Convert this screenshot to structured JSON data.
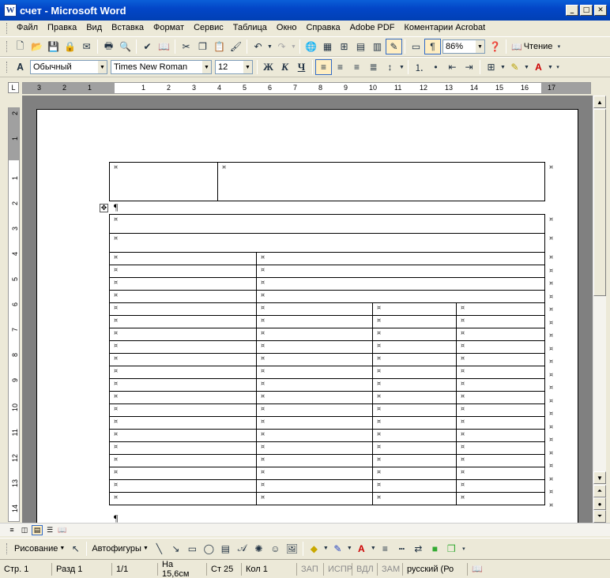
{
  "window": {
    "title": "счет - Microsoft Word",
    "app_icon": "W",
    "minimize": "_",
    "maximize": "□",
    "close": "✕"
  },
  "menu": [
    "Файл",
    "Правка",
    "Вид",
    "Вставка",
    "Формат",
    "Сервис",
    "Таблица",
    "Окно",
    "Справка",
    "Adobe PDF",
    "Коментарии Acrobat"
  ],
  "toolbar_standard": {
    "zoom": "86%",
    "reading_label": "Чтение"
  },
  "toolbar_format": {
    "style": "Обычный",
    "font": "Times New Roman",
    "size": "12",
    "bold": "Ж",
    "italic": "К",
    "underline": "Ч"
  },
  "ruler_h": [
    "3",
    "2",
    "1",
    "1",
    "2",
    "3",
    "4",
    "5",
    "6",
    "7",
    "8",
    "9",
    "10",
    "11",
    "12",
    "13",
    "14",
    "15",
    "16",
    "17"
  ],
  "ruler_v": [
    "2",
    "1",
    "1",
    "2",
    "3",
    "4",
    "5",
    "6",
    "7",
    "8",
    "9",
    "10",
    "11",
    "12",
    "13",
    "14"
  ],
  "doc": {
    "cell_mark": "¤",
    "pilcrow": "¶"
  },
  "drawing": {
    "draw_label": "Рисование",
    "autoshapes_label": "Автофигуры"
  },
  "status": {
    "page": "Стр. 1",
    "section": "Разд 1",
    "pages": "1/1",
    "at": "На 15,6см",
    "line": "Ст 25",
    "col": "Кол 1",
    "rec": "ЗАП",
    "trk": "ИСПР",
    "ext": "ВДЛ",
    "ovr": "ЗАМ",
    "lang": "русский (Ро"
  }
}
